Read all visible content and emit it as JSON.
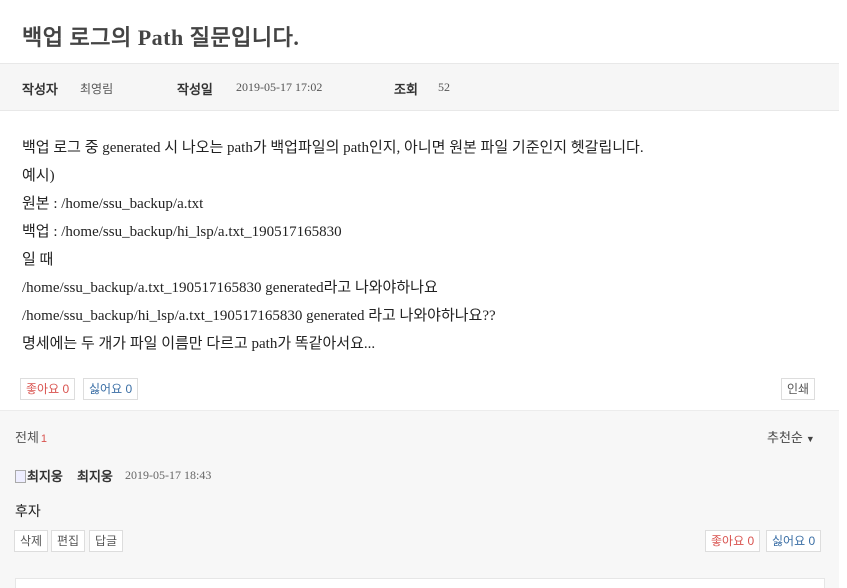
{
  "post": {
    "title": "백업 로그의 Path 질문입니다.",
    "meta": {
      "author_label": "작성자",
      "author": "최영림",
      "date_label": "작성일",
      "date": "2019-05-17 17:02",
      "views_label": "조회",
      "views": "52"
    },
    "body_lines": [
      "백업 로그 중 generated 시 나오는 path가 백업파일의 path인지, 아니면 원본 파일 기준인지 헷갈립니다.",
      "예시)",
      "원본 : /home/ssu_backup/a.txt",
      "백업 : /home/ssu_backup/hi_lsp/a.txt_190517165830",
      "일 때",
      "/home/ssu_backup/a.txt_190517165830 generated라고 나와야하나요",
      "/home/ssu_backup/hi_lsp/a.txt_190517165830 generated 라고 나와야하나요??",
      "명세에는 두 개가 파일 이름만 다르고 path가 똑같아서요..."
    ],
    "like_label": "좋아요",
    "like_count": "0",
    "dislike_label": "싫어요",
    "dislike_count": "0",
    "print_label": "인쇄"
  },
  "comments": {
    "total_label": "전체",
    "total_count": "1",
    "sort_label": "추천순",
    "items": [
      {
        "avatar_alt": "최지웅",
        "author": "최지웅",
        "date": "2019-05-17 18:43",
        "body": "후자",
        "delete_label": "삭제",
        "edit_label": "편집",
        "reply_label": "답글",
        "like_label": "좋아요",
        "like_count": "0",
        "dislike_label": "싫어요",
        "dislike_count": "0"
      }
    ]
  },
  "colors": {
    "like": "#d9534f",
    "dislike": "#3a6ea5",
    "meta_bg": "#f6f6f6",
    "comments_bg": "#f7f7f7"
  },
  "icons": {
    "sort_caret": "caret-down-icon",
    "avatar": "broken-image-icon"
  }
}
